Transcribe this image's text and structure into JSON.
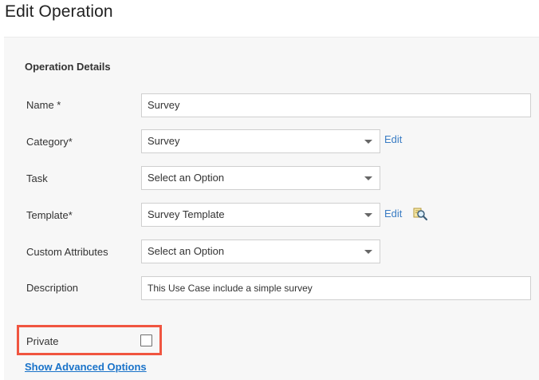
{
  "page": {
    "title": "Edit Operation"
  },
  "form": {
    "section_title": "Operation Details",
    "name": {
      "label": "Name *",
      "value": "Survey"
    },
    "category": {
      "label": "Category*",
      "value": "Survey",
      "edit_label": "Edit"
    },
    "task": {
      "label": "Task",
      "value": "Select an Option"
    },
    "template": {
      "label": "Template*",
      "value": "Survey Template",
      "edit_label": "Edit",
      "lookup_icon": "magnifier-lookup-icon"
    },
    "custom_attributes": {
      "label": "Custom Attributes",
      "value": "Select an Option"
    },
    "description": {
      "label": "Description",
      "value": "This Use Case include a simple survey"
    },
    "private": {
      "label": "Private",
      "checked": false
    },
    "advanced_link": "Show Advanced Options"
  },
  "colors": {
    "link": "#3b7dc4",
    "highlight_border": "#f05540",
    "panel_bg": "#f7f7f7"
  }
}
